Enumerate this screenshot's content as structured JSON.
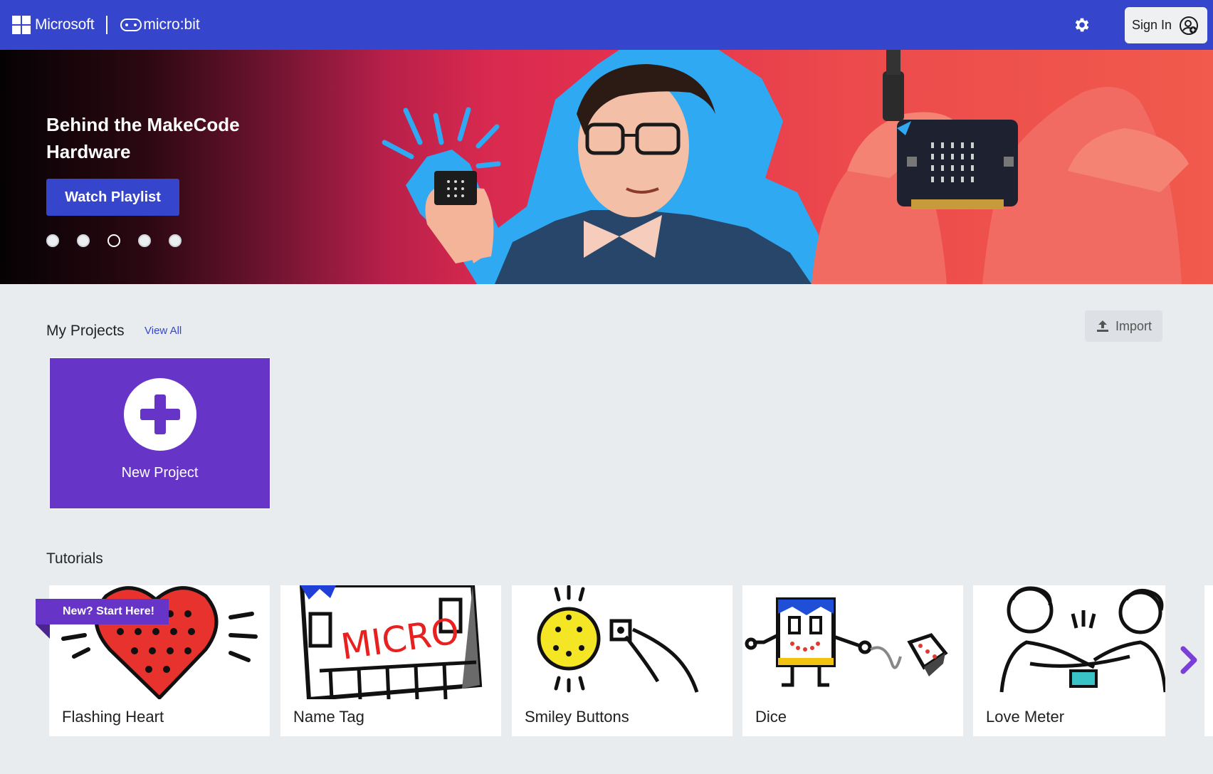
{
  "topbar": {
    "brand_ms": "Microsoft",
    "brand_microbit": "micro:bit",
    "settings_icon": "gear-icon",
    "signin_label": "Sign In",
    "signin_icon": "user-add-icon",
    "colors": {
      "background": "#3545cc",
      "signin_bg": "#eef0f2"
    }
  },
  "hero": {
    "title": "Behind the MakeCode Hardware",
    "button_label": "Watch Playlist",
    "slides": {
      "count": 5,
      "active_index": 2
    }
  },
  "projects": {
    "title": "My Projects",
    "view_all": "View All",
    "import_label": "Import",
    "import_icon": "upload-icon",
    "new_project_label": "New Project",
    "colors": {
      "card": "#6734c8"
    }
  },
  "tutorials": {
    "title": "Tutorials",
    "ribbon": "New? Start Here!",
    "next_icon": "chevron-right-icon",
    "items": [
      {
        "name": "Flashing Heart",
        "art": "heart-drawing"
      },
      {
        "name": "Name Tag",
        "art": "micro-nametag-drawing"
      },
      {
        "name": "Smiley Buttons",
        "art": "smiley-button-drawing"
      },
      {
        "name": "Dice",
        "art": "dice-robot-drawing"
      },
      {
        "name": "Love Meter",
        "art": "love-meter-drawing"
      }
    ]
  }
}
